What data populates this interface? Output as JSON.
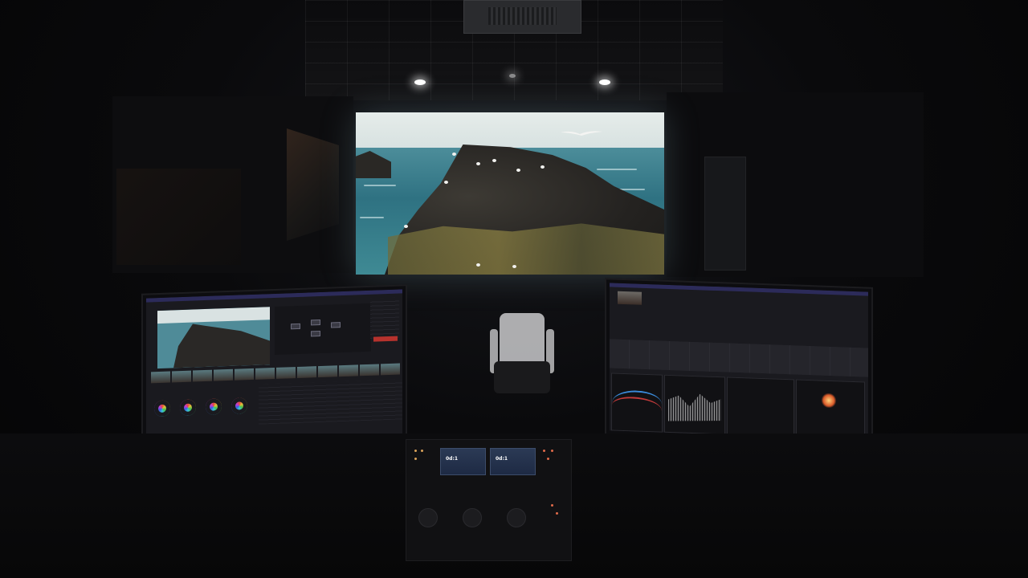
{
  "scene": {
    "control_panel_displays": [
      {
        "value": "0d:1"
      },
      {
        "value": "0d:1"
      }
    ],
    "monitors": [
      "left-grading-monitor",
      "right-scopes-monitor"
    ]
  },
  "colors": {
    "sky": "#e6ecea",
    "sea": "#2f7282",
    "rock": "#242220",
    "moss": "#8a7f42",
    "ui_accent": "#2c2b5a",
    "record_red": "#b6322d"
  }
}
